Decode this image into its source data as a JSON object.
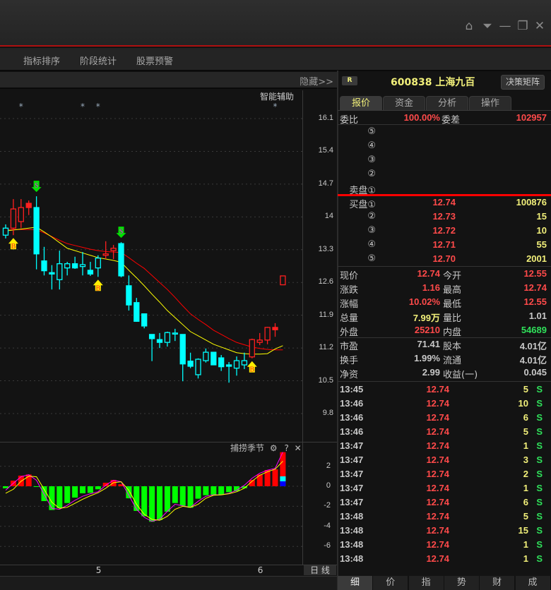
{
  "window": {
    "icons": [
      "home-icon",
      "dropdown-icon",
      "minimize-icon",
      "restore-icon",
      "close-icon"
    ]
  },
  "menu": [
    "指标排序",
    "阶段统计",
    "股票预警"
  ],
  "toolbar": {
    "hide_label": "隐藏>>"
  },
  "chart": {
    "assist_label": "智能辅助",
    "indicator_name": "捕捞季节",
    "help": "?",
    "close": "✕",
    "period_label": "日 线"
  },
  "colors": {
    "up": "#ff2020",
    "down": "#00ffff",
    "ma_fast": "#ffff00",
    "ma_slow": "#ff0000",
    "macd_pos": "#ff0000",
    "macd_neg": "#00ff00",
    "signal_line": "#ff00ff",
    "accent": "#b01010"
  },
  "chart_data": [
    {
      "type": "candlestick",
      "y_ticks": [
        16.1,
        15.4,
        14.7,
        14.0,
        13.3,
        12.6,
        11.9,
        11.2,
        10.5,
        9.8
      ],
      "ylim": [
        9.8,
        16.1
      ],
      "grid": true,
      "x_labels": [
        {
          "index": 12,
          "label": "5"
        },
        {
          "index": 33,
          "label": "6"
        }
      ],
      "candles": [
        [
          13.61,
          13.84,
          13.54,
          13.76,
          "c"
        ],
        [
          13.76,
          14.38,
          13.61,
          14.17,
          "r"
        ],
        [
          13.9,
          14.38,
          13.76,
          14.2,
          "r"
        ],
        [
          14.29,
          14.35,
          14.04,
          14.2,
          "r"
        ],
        [
          14.2,
          14.44,
          12.88,
          13.21,
          "c"
        ],
        [
          13.06,
          13.36,
          12.75,
          12.85,
          "c"
        ],
        [
          12.81,
          12.97,
          12.45,
          12.78,
          "c"
        ],
        [
          12.66,
          13.28,
          12.45,
          13.0,
          "c"
        ],
        [
          12.91,
          13.04,
          12.75,
          13.0,
          "c"
        ],
        [
          13.0,
          13.15,
          12.89,
          12.91,
          "c"
        ],
        [
          12.94,
          13.25,
          12.75,
          12.98,
          "c"
        ],
        [
          12.86,
          13.04,
          12.74,
          12.78,
          "c"
        ],
        [
          12.91,
          13.18,
          12.72,
          13.12,
          "c"
        ],
        [
          13.18,
          13.48,
          13.1,
          13.21,
          "r"
        ],
        [
          13.28,
          13.4,
          13.1,
          13.33,
          "r"
        ],
        [
          13.43,
          13.46,
          12.71,
          12.74,
          "c"
        ],
        [
          12.53,
          12.75,
          12.0,
          12.12,
          "c"
        ],
        [
          12.17,
          12.27,
          11.76,
          11.77,
          "c"
        ],
        [
          11.93,
          11.93,
          11.62,
          11.67,
          "c"
        ],
        [
          11.49,
          11.49,
          10.92,
          11.4,
          "c"
        ],
        [
          11.38,
          11.52,
          11.2,
          11.32,
          "c"
        ],
        [
          11.32,
          11.55,
          11.23,
          11.53,
          "c"
        ],
        [
          11.5,
          11.61,
          11.35,
          11.52,
          "c"
        ],
        [
          11.49,
          11.49,
          10.49,
          10.86,
          "c"
        ],
        [
          10.92,
          11.1,
          10.77,
          10.81,
          "c"
        ],
        [
          10.63,
          10.98,
          10.55,
          10.96,
          "c"
        ],
        [
          10.93,
          11.19,
          10.89,
          11.11,
          "c"
        ],
        [
          11.11,
          11.11,
          10.84,
          10.84,
          "c"
        ],
        [
          10.99,
          11.05,
          10.71,
          10.8,
          "c"
        ],
        [
          10.84,
          10.9,
          10.46,
          10.81,
          "c"
        ],
        [
          10.77,
          11.02,
          10.61,
          10.93,
          "c"
        ],
        [
          10.84,
          11.1,
          10.75,
          10.93,
          "c"
        ],
        [
          11.01,
          11.4,
          10.98,
          11.38,
          "r"
        ],
        [
          11.32,
          11.52,
          11.26,
          11.37,
          "r"
        ],
        [
          11.37,
          11.65,
          11.28,
          11.64,
          "r"
        ],
        [
          11.64,
          11.73,
          11.44,
          11.59,
          "r"
        ],
        [
          12.55,
          12.74,
          12.55,
          12.74,
          "r"
        ]
      ],
      "ma_fast": [
        13.7,
        13.72,
        13.74,
        13.76,
        13.78,
        13.68,
        13.57,
        13.45,
        13.33,
        13.28,
        13.23,
        13.18,
        13.13,
        13.1,
        13.07,
        13.03,
        12.86,
        12.7,
        12.53,
        12.35,
        12.18,
        12.0,
        11.85,
        11.7,
        11.55,
        11.46,
        11.37,
        11.28,
        11.22,
        11.16,
        11.1,
        11.08,
        11.07,
        11.07,
        11.08,
        11.18,
        11.25
      ],
      "ma_slow": [
        13.73,
        13.73,
        13.73,
        13.73,
        13.73,
        13.66,
        13.58,
        13.5,
        13.43,
        13.39,
        13.35,
        13.31,
        13.28,
        13.26,
        13.25,
        13.24,
        13.13,
        13.01,
        12.9,
        12.75,
        12.6,
        12.45,
        12.28,
        12.1,
        11.93,
        11.81,
        11.7,
        11.58,
        11.49,
        11.4,
        11.32,
        11.27,
        11.22,
        11.19,
        11.17,
        11.16,
        11.16
      ],
      "signals": [
        {
          "index": 1,
          "type": "B"
        },
        {
          "index": 4,
          "type": "S"
        },
        {
          "index": 12,
          "type": "B"
        },
        {
          "index": 15,
          "type": "S"
        },
        {
          "index": 32,
          "type": "B"
        }
      ],
      "stars": [
        2,
        10,
        12,
        35
      ]
    },
    {
      "type": "bar",
      "title": "捕捞季节",
      "y_ticks": [
        2,
        0,
        -2,
        -4,
        -6
      ],
      "ylim": [
        -7,
        3.5
      ],
      "grid": true,
      "values": [
        -0.2,
        0.56,
        1.06,
        1.17,
        -0.05,
        -1.48,
        -2.37,
        -2.18,
        -1.67,
        -1.13,
        -0.7,
        -0.66,
        -0.3,
        0.35,
        0.63,
        0.2,
        -1.2,
        -2.46,
        -3.0,
        -3.54,
        -3.36,
        -2.54,
        -1.67,
        -1.95,
        -2.14,
        -1.24,
        -0.89,
        -0.85,
        -0.85,
        -0.59,
        -0.5,
        -0.19,
        0.63,
        1.17,
        1.62,
        1.69,
        3.4
      ],
      "last_bar_segments": {
        "cyan": [
          0.49,
          0.99
        ],
        "blue": [
          0,
          0.49
        ]
      },
      "line_magenta": [
        -0.4,
        0.3,
        0.95,
        1.15,
        0.6,
        -0.8,
        -2.2,
        -2.3,
        -1.9,
        -1.4,
        -1.0,
        -0.75,
        -0.55,
        0.1,
        0.6,
        0.45,
        -0.9,
        -2.3,
        -3.1,
        -3.5,
        -3.3,
        -2.5,
        -1.8,
        -1.95,
        -2.1,
        -1.5,
        -1.0,
        -0.85,
        -0.85,
        -0.7,
        -0.4,
        0.1,
        0.8,
        1.3,
        1.6,
        1.8,
        3.4
      ],
      "line_yellow": [
        -0.7,
        -0.3,
        0.5,
        1.0,
        0.95,
        -0.3,
        -1.6,
        -2.2,
        -2.1,
        -1.7,
        -1.3,
        -0.95,
        -0.65,
        -0.2,
        0.35,
        0.45,
        -0.4,
        -1.8,
        -2.8,
        -3.3,
        -3.4,
        -3.0,
        -2.3,
        -2.0,
        -2.1,
        -1.8,
        -1.2,
        -0.9,
        -0.85,
        -0.75,
        -0.55,
        -0.2,
        0.5,
        1.1,
        1.45,
        1.7,
        2.5
      ]
    }
  ],
  "quote": {
    "badge": "R",
    "stock": "600838 上海九百",
    "decision_button": "决策矩阵",
    "tabs": [
      "报价",
      "资金",
      "分析",
      "操作"
    ],
    "ratio": {
      "label": "委比",
      "value": "100.00%",
      "label2": "委差",
      "value2": "102957"
    },
    "sell": [
      {
        "label": "⑤",
        "price": "",
        "vol": ""
      },
      {
        "label": "④",
        "price": "",
        "vol": ""
      },
      {
        "label": "③",
        "price": "",
        "vol": ""
      },
      {
        "label": "②",
        "price": "",
        "vol": ""
      },
      {
        "label": "卖盘①",
        "price": "",
        "vol": ""
      }
    ],
    "buy": [
      {
        "label": "买盘①",
        "price": "12.74",
        "vol": "100876"
      },
      {
        "label": "②",
        "price": "12.73",
        "vol": "15"
      },
      {
        "label": "③",
        "price": "12.72",
        "vol": "10"
      },
      {
        "label": "④",
        "price": "12.71",
        "vol": "55"
      },
      {
        "label": "⑤",
        "price": "12.70",
        "vol": "2001"
      }
    ],
    "stats1": [
      {
        "l1": "现价",
        "v1": "12.74",
        "c1": "red",
        "l2": "今开",
        "v2": "12.55",
        "c2": "red"
      },
      {
        "l1": "涨跌",
        "v1": "1.16",
        "c1": "red",
        "l2": "最高",
        "v2": "12.74",
        "c2": "red"
      },
      {
        "l1": "涨幅",
        "v1": "10.02%",
        "c1": "red",
        "l2": "最低",
        "v2": "12.55",
        "c2": "red"
      },
      {
        "l1": "总量",
        "v1": "7.99万",
        "c1": "yel",
        "l2": "量比",
        "v2": "1.01",
        "c2": "gry"
      },
      {
        "l1": "外盘",
        "v1": "25210",
        "c1": "red",
        "l2": "内盘",
        "v2": "54689",
        "c2": "grn"
      }
    ],
    "stats2": [
      {
        "l1": "市盈",
        "v1": "71.41",
        "c1": "gry",
        "l2": "股本",
        "v2": "4.01亿",
        "c2": "gry"
      },
      {
        "l1": "换手",
        "v1": "1.99%",
        "c1": "gry",
        "l2": "流通",
        "v2": "4.01亿",
        "c2": "gry"
      },
      {
        "l1": "净资",
        "v1": "2.99",
        "c1": "gry",
        "l2": "收益(一)",
        "v2": "0.045",
        "c2": "gry"
      }
    ],
    "trades": [
      {
        "time": "13:45",
        "price": "12.74",
        "vol": "5",
        "side": "S"
      },
      {
        "time": "13:46",
        "price": "12.74",
        "vol": "10",
        "side": "S"
      },
      {
        "time": "13:46",
        "price": "12.74",
        "vol": "6",
        "side": "S"
      },
      {
        "time": "13:46",
        "price": "12.74",
        "vol": "5",
        "side": "S"
      },
      {
        "time": "13:47",
        "price": "12.74",
        "vol": "1",
        "side": "S"
      },
      {
        "time": "13:47",
        "price": "12.74",
        "vol": "3",
        "side": "S"
      },
      {
        "time": "13:47",
        "price": "12.74",
        "vol": "2",
        "side": "S"
      },
      {
        "time": "13:47",
        "price": "12.74",
        "vol": "1",
        "side": "S"
      },
      {
        "time": "13:47",
        "price": "12.74",
        "vol": "6",
        "side": "S"
      },
      {
        "time": "13:48",
        "price": "12.74",
        "vol": "5",
        "side": "S"
      },
      {
        "time": "13:48",
        "price": "12.74",
        "vol": "15",
        "side": "S"
      },
      {
        "time": "13:48",
        "price": "12.74",
        "vol": "1",
        "side": "S"
      },
      {
        "time": "13:48",
        "price": "12.74",
        "vol": "1",
        "side": "S"
      }
    ],
    "bottom_tabs": [
      "细",
      "价",
      "指",
      "势",
      "财",
      "成"
    ]
  }
}
